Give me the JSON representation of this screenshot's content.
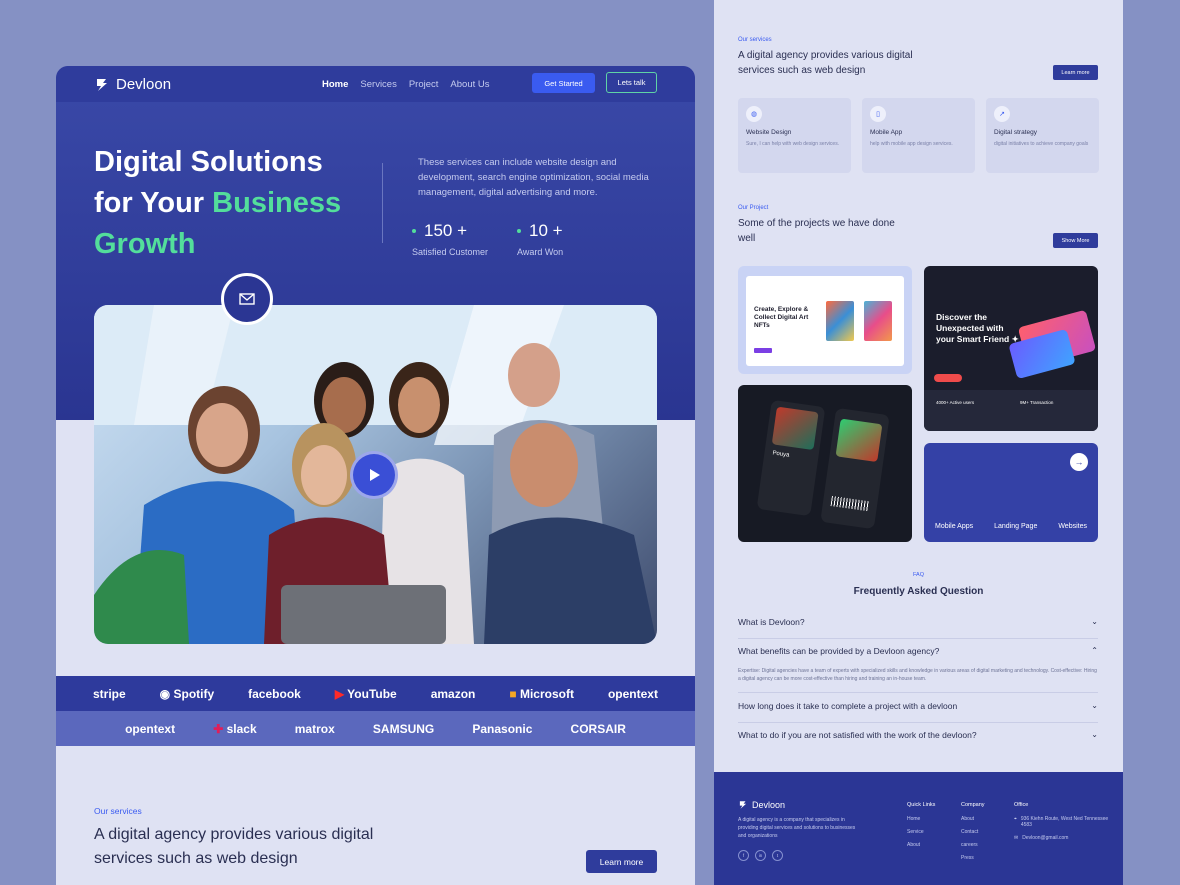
{
  "nav": {
    "brand": "Devloon",
    "links": [
      "Home",
      "Services",
      "Project",
      "About Us"
    ],
    "get_started": "Get Started",
    "lets_talk": "Lets talk"
  },
  "hero": {
    "title_line1": "Digital Solutions",
    "title_line2_a": "for Your ",
    "title_line2_b": "Business",
    "title_line3": "Growth",
    "description": "These services can include website design and development, search engine optimization, social media management, digital advertising and more.",
    "stats": [
      {
        "value": "150 +",
        "label": "Satisfied Customer"
      },
      {
        "value": "10 +",
        "label": "Award Won"
      }
    ],
    "badge_text": "Send message"
  },
  "brands_row1": [
    "stripe",
    "Spotify",
    "facebook",
    "YouTube",
    "amazon",
    "Microsoft",
    "opentext"
  ],
  "brands_row2": [
    "opentext",
    "slack",
    "matrox",
    "SAMSUNG",
    "Panasonic",
    "CORSAIR"
  ],
  "services_left": {
    "tag": "Our services",
    "title": "A digital agency provides various digital services such as web design",
    "button": "Learn more"
  },
  "services_right": {
    "tag": "Our services",
    "title": "A digital agency provides various digital services such as web design",
    "button": "Learn more",
    "cards": [
      {
        "title": "Website Design",
        "desc": "Sure, I can help with web design services."
      },
      {
        "title": "Mobile App",
        "desc": "help with mobile app design services."
      },
      {
        "title": "Digital strategy",
        "desc": "digital initiatives to achieve company goals"
      }
    ]
  },
  "projects": {
    "tag": "Our Project",
    "title": "Some of the projects we have done well",
    "button": "Show More",
    "p1_text": "Create, Explore & Collect Digital Art NFTs",
    "p2_text": "Discover the Unexpected with your Smart Friend ✦",
    "p2_stat1": "4000+ Active users",
    "p2_stat2": "9M+ Transaction",
    "p3_name": "Pouya",
    "categories": [
      "Mobile Apps",
      "Landing Page",
      "Websites"
    ]
  },
  "faq": {
    "tag": "FAQ",
    "title": "Frequently Asked Question",
    "items": [
      "What is Devloon?",
      "What benefits can be provided by a Devloon agency?",
      "How long does it take to complete a project with a devloon",
      "What to do if you are not satisfied with the work of the devloon?"
    ],
    "answer": "Expertise: Digital agencies have a team of experts with specialized skills and knowledge in various areas of digital marketing and technology. Cost-effective: Hiring a digital agency can be more cost-effective than hiring and training an in-house team."
  },
  "footer": {
    "brand": "Devloon",
    "desc": "A digital agency is a company that specializes in providing digital services and solutions to businesses and organizations",
    "quick_links_title": "Quick Links",
    "quick_links": [
      "Home",
      "Service",
      "About"
    ],
    "company_title": "Company",
    "company": [
      "About",
      "Contact",
      "careers",
      "Press"
    ],
    "office_title": "Office",
    "address": "936 Kiehn Route, West Ned Tennessee 4583",
    "email": "Devloon@gmail.com"
  }
}
